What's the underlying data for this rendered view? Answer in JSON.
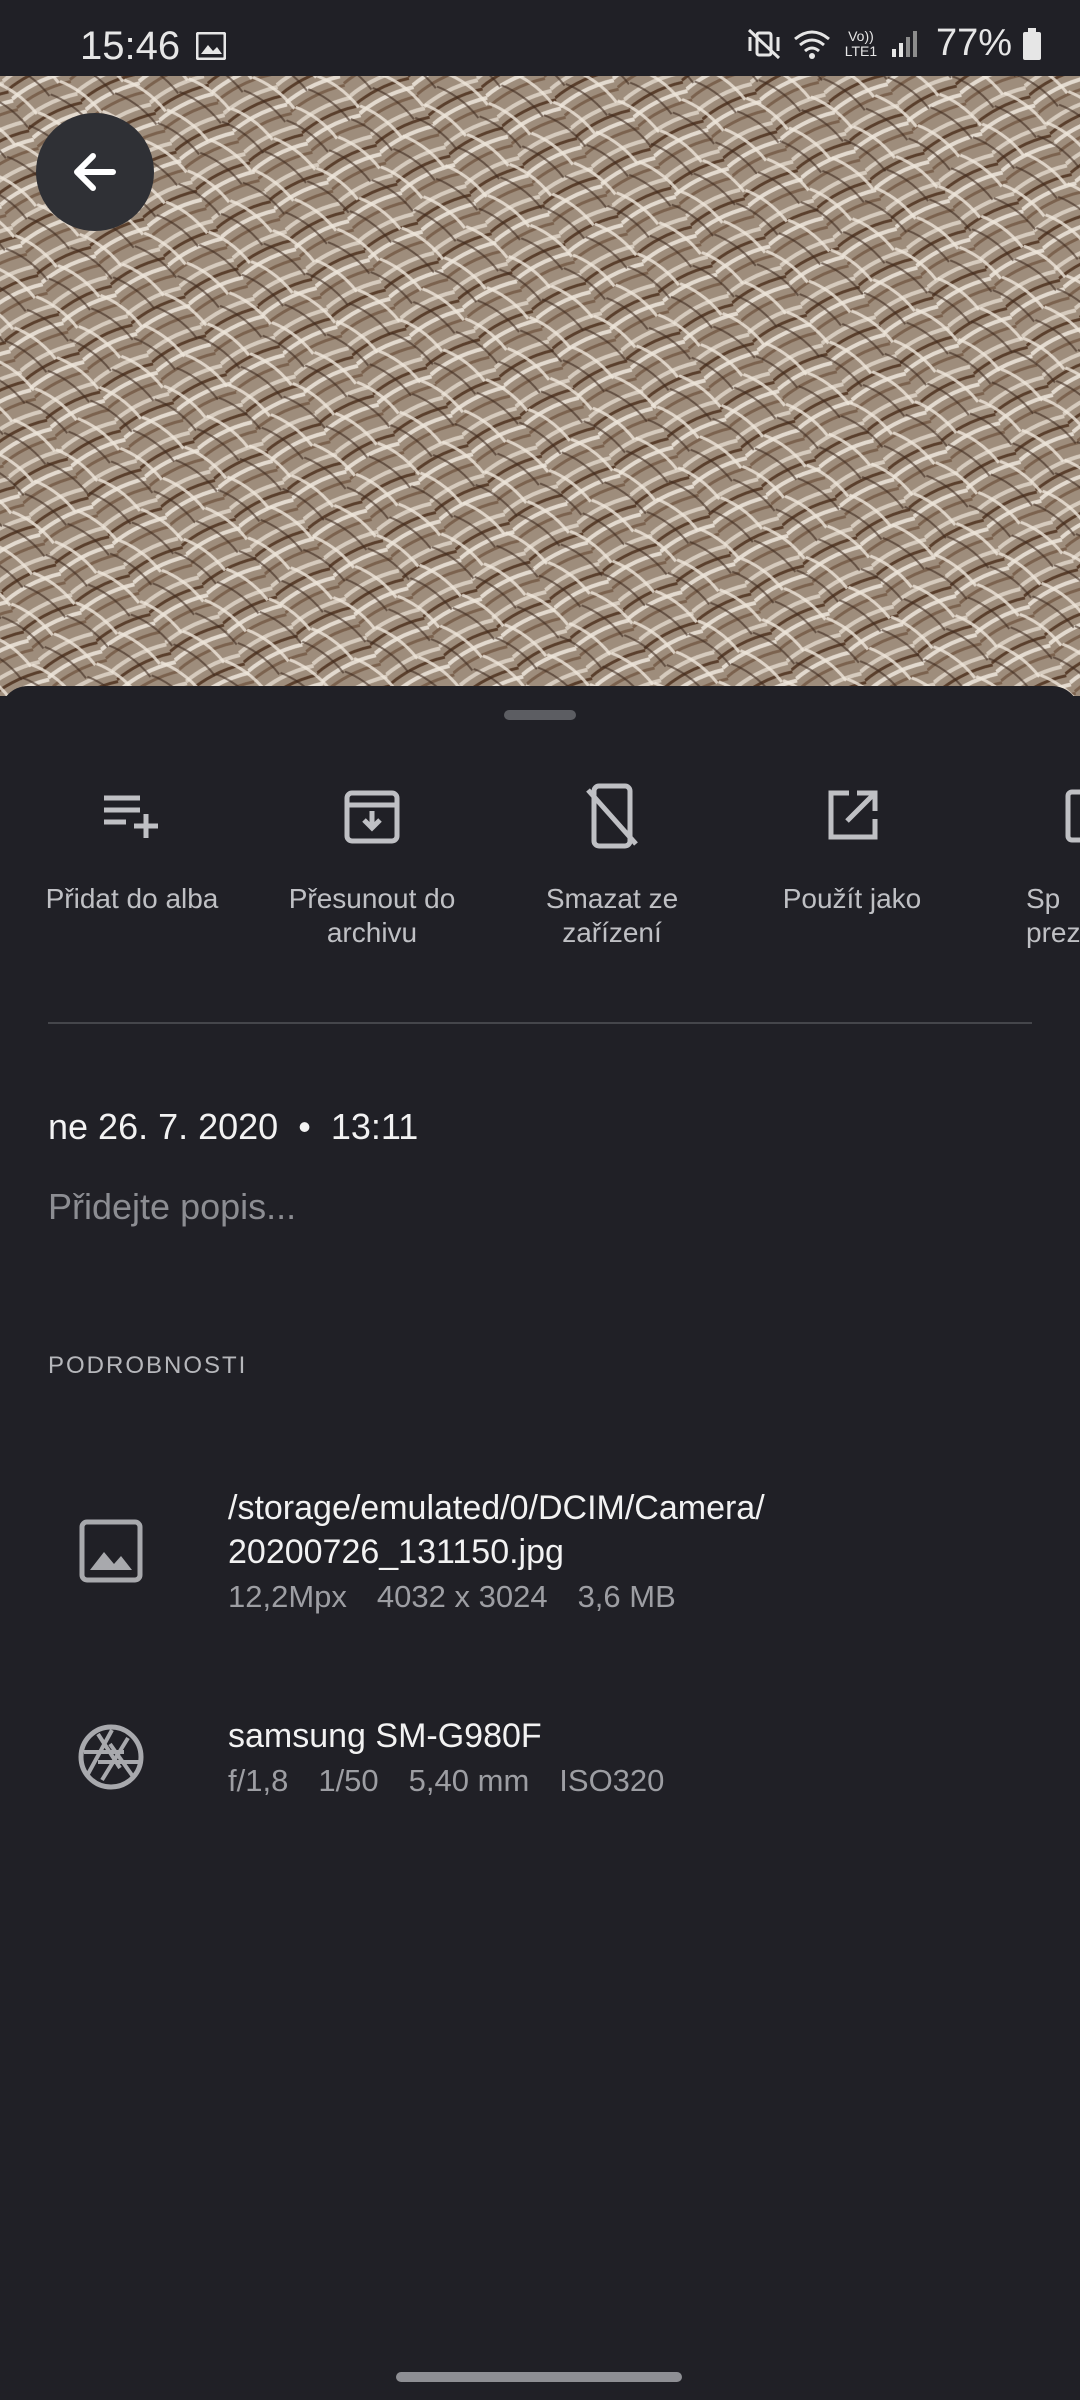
{
  "status_bar": {
    "time": "15:46",
    "battery": "77%",
    "volte_label": "Vo)) LTE1",
    "icons": [
      "gallery-icon",
      "mute-vibrate-icon",
      "wifi-icon",
      "volte-icon",
      "signal-icon",
      "battery-icon"
    ]
  },
  "photo": {
    "back_icon": "arrow-left-icon"
  },
  "actions": [
    {
      "label": "Přidat do alba",
      "icon": "playlist-add-icon"
    },
    {
      "label": "Přesunout do archivu",
      "icon": "archive-icon"
    },
    {
      "label": "Smazat ze zařízení",
      "icon": "phone-delete-icon"
    },
    {
      "label": "Použít jako",
      "icon": "open-external-icon"
    },
    {
      "label": "Sp prez",
      "icon": "slideshow-icon"
    }
  ],
  "info": {
    "date": "ne 26. 7. 2020",
    "separator": "•",
    "time": "13:11",
    "description_placeholder": "Přidejte popis..."
  },
  "details": {
    "section_title": "PODROBNOSTI",
    "file": {
      "path_line1": "/storage/emulated/0/DCIM/Camera/",
      "path_line2": "20200726_131150.jpg",
      "megapixels": "12,2Mpx",
      "resolution": "4032 x 3024",
      "size": "3,6 MB",
      "icon": "image-icon"
    },
    "camera": {
      "model": "samsung SM-G980F",
      "aperture": "f/1,8",
      "shutter": "1/50",
      "focal": "5,40 mm",
      "iso": "ISO320",
      "icon": "aperture-icon"
    }
  },
  "colors": {
    "background": "#202026",
    "text_primary": "#f2f2f2",
    "text_secondary": "#9d9ea3"
  }
}
